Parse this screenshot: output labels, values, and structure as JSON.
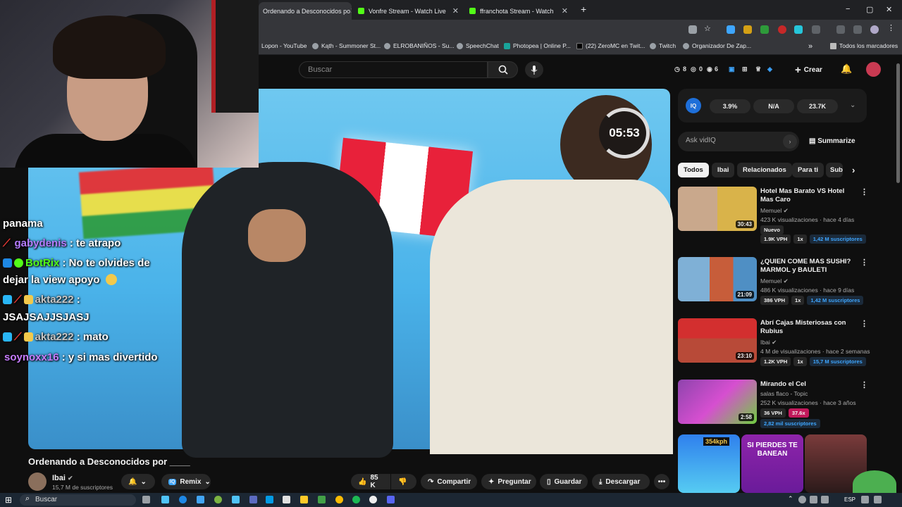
{
  "browser": {
    "tabs": [
      {
        "label": "Ordenando a Desconocidos po",
        "active": true
      },
      {
        "label": "Vonfre Stream - Watch Live",
        "active": false
      },
      {
        "label": "ffranchota Stream - Watch",
        "active": false
      }
    ],
    "new_tab": "+",
    "window_controls": [
      "−",
      "▢",
      "✕"
    ],
    "bookmarks": [
      "Lopon - YouTube",
      "Kąth - Summoner St...",
      "ELROBANIÑOS - Su...",
      "SpeechChat",
      "Photopea | Online P...",
      "(22) ZeroMC en Twit...",
      "Twitch",
      "Organizador De Zap..."
    ],
    "bookmarks_overflow": "»",
    "all_bookmarks": "Todos los marcadores"
  },
  "youtube": {
    "search_placeholder": "Buscar",
    "stats": {
      "views": "8",
      "eye": "0",
      "liked": "6"
    },
    "create": "Crear"
  },
  "video": {
    "timer": "05:53",
    "title": "Ordenando a Desconocidos por ____",
    "channel": "Ibai",
    "subscribers": "15,7 M de suscriptores",
    "remix": "Remix",
    "likes": "85 K",
    "share": "Compartir",
    "ask": "Preguntar",
    "save": "Guardar",
    "download": "Descargar",
    "more": "•••"
  },
  "chat": [
    {
      "user": "",
      "text": "panama",
      "color": "#ffffff"
    },
    {
      "user": "gabydenis",
      "text": " : te atrapo",
      "color": "#b47cff"
    },
    {
      "user": "BotRix",
      "text": " : No te olvides de",
      "color": "#53fc18"
    },
    {
      "user": "",
      "text": "dejar la view apoyo",
      "color": "#ffffff"
    },
    {
      "user": "akta222",
      "text": " :",
      "color": "#c7c7c7"
    },
    {
      "user": "",
      "text": "JSAJSAJJSJASJ",
      "color": "#ffffff"
    },
    {
      "user": "akta222",
      "text": " : mato",
      "color": "#c7c7c7"
    },
    {
      "user": "soynoxx16",
      "text": " : y si mas divertido",
      "color": "#c77dff"
    }
  ],
  "vidiq": {
    "label": "IQ",
    "metrics": [
      "3.9%",
      "N/A",
      "23.7K"
    ],
    "ask_placeholder": "Ask vidIQ",
    "summarize": "Summarize"
  },
  "chips": [
    "Todos",
    "Ibai",
    "Relacionados",
    "Para ti",
    "Sub"
  ],
  "related": [
    {
      "title": "Hotel Mas Barato VS Hotel Mas Caro",
      "channel": "Memuel",
      "meta": "423 K visualizaciones · hace 4 días",
      "duration": "30:43",
      "badge": "Nuevo",
      "tags": [
        "1.9K VPH",
        "1x",
        "1,42 M suscriptores"
      ]
    },
    {
      "title": "¿QUIEN COME MAS SUSHI? MARMOL y BAULETI",
      "channel": "Memuel",
      "meta": "486 K visualizaciones · hace 9 días",
      "duration": "21:09",
      "badge": "",
      "tags": [
        "386 VPH",
        "1x",
        "1,42 M suscriptores"
      ]
    },
    {
      "title": "Abrí Cajas Misteriosas con Rubius",
      "channel": "Ibai",
      "meta": "4 M de visualizaciones · hace 2 semanas",
      "duration": "23:10",
      "badge": "",
      "tags": [
        "1.2K VPH",
        "1x",
        "15,7 M suscriptores"
      ]
    },
    {
      "title": "Mirando el Cel",
      "channel": "salas flaco - Topic",
      "meta": "252 K visualizaciones · hace 3 años",
      "duration": "2:58",
      "badge": "",
      "tags": [
        "36 VPH",
        "37.6x",
        "2,82 mil suscriptores"
      ]
    }
  ],
  "shorts": [
    "354kph",
    "SI PIERDES TE BANEAN",
    ""
  ],
  "taskbar": {
    "search": "Buscar",
    "lang": "ESP"
  },
  "colors": {
    "accent": "#3ea6ff",
    "kick_green": "#53fc18",
    "yt_bg": "#0f0f0f"
  }
}
